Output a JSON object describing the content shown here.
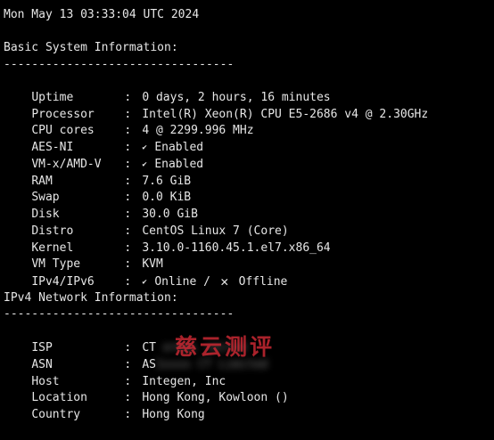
{
  "header": {
    "datetime": "Mon May 13 03:33:04 UTC 2024"
  },
  "basic": {
    "title": "Basic System Information:",
    "divider": "---------------------------------",
    "rows": [
      {
        "key": "Uptime",
        "value": "0 days, 2 hours, 16 minutes"
      },
      {
        "key": "Processor",
        "value": "Intel(R) Xeon(R) CPU E5-2686 v4 @ 2.30GHz"
      },
      {
        "key": "CPU cores",
        "value": "4 @ 2299.996 MHz"
      },
      {
        "key": "AES-NI",
        "value": "Enabled"
      },
      {
        "key": "VM-x/AMD-V",
        "value": "Enabled"
      },
      {
        "key": "RAM",
        "value": "7.6 GiB"
      },
      {
        "key": "Swap",
        "value": "0.0 KiB"
      },
      {
        "key": "Disk",
        "value": "30.0 GiB"
      },
      {
        "key": "Distro",
        "value": "CentOS Linux 7 (Core)"
      },
      {
        "key": "Kernel",
        "value": "3.10.0-1160.45.1.el7.x86_64"
      },
      {
        "key": "VM Type",
        "value": "KVM"
      },
      {
        "key": "IPv4/IPv6",
        "online": "Online",
        "slash": "/",
        "offline": "Offline"
      }
    ]
  },
  "network": {
    "title": "IPv4 Network Information:",
    "divider": "---------------------------------",
    "rows": [
      {
        "key": "ISP",
        "value": "CT ",
        "redacted": "ermaL imited"
      },
      {
        "key": "ASN",
        "value": "AS",
        "redacted": "1xxxx CT Limited"
      },
      {
        "key": "Host",
        "value": "Integen, Inc"
      },
      {
        "key": "Location",
        "value": "Hong Kong, Kowloon ()"
      },
      {
        "key": "Country",
        "value": "Hong Kong"
      }
    ]
  },
  "watermark": {
    "text": "慈云测评",
    "color": "#c82832"
  },
  "icons": {
    "check": "check-icon",
    "cross": "cross-icon"
  },
  "colors": {
    "background": "#000000",
    "text": "#e6e6e6"
  }
}
